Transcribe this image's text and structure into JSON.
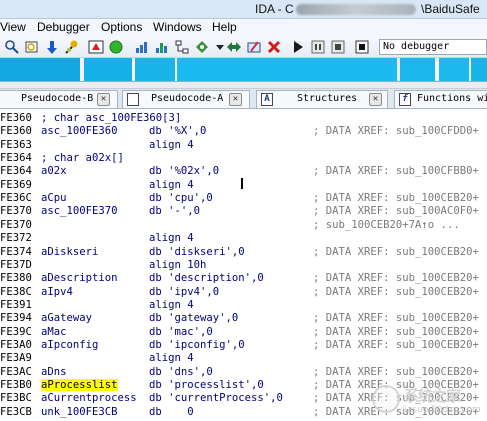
{
  "window": {
    "title_prefix": "IDA - C",
    "title_suffix": "\\BaiduSafe"
  },
  "menu": [
    "View",
    "Debugger",
    "Options",
    "Windows",
    "Help"
  ],
  "toolbar": {
    "debugger_select": "No debugger"
  },
  "tabs": [
    {
      "label": "Pseudocode-B"
    },
    {
      "label": "Pseudocode-A"
    },
    {
      "label": "Structures"
    },
    {
      "label": "Functions wind"
    }
  ],
  "listing": [
    {
      "addr": "FE360",
      "label": "; char asc_100FE360[3]",
      "op": "",
      "comment": "",
      "kind": "cmt"
    },
    {
      "addr": "FE360",
      "label": "asc_100FE360",
      "op": "db '%X',0",
      "comment": "; DATA XREF: sub_100CFDD0+",
      "kind": "data"
    },
    {
      "addr": "FE363",
      "label": "",
      "op": "align 4",
      "comment": "",
      "kind": "data"
    },
    {
      "addr": "FE364",
      "label": "; char a02x[]",
      "op": "",
      "comment": "",
      "kind": "cmt"
    },
    {
      "addr": "FE364",
      "label": "a02x",
      "op": "db '%02x',0",
      "comment": "; DATA XREF: sub_100CFBB0+",
      "kind": "data"
    },
    {
      "addr": "FE369",
      "label": "",
      "op": "align 4",
      "comment": "",
      "kind": "data"
    },
    {
      "addr": "FE36C",
      "label": "aCpu",
      "op": "db 'cpu',0",
      "comment": "; DATA XREF: sub_100CEB20+",
      "kind": "data"
    },
    {
      "addr": "FE370",
      "label": "asc_100FE370",
      "op": "db '-',0",
      "comment": "; DATA XREF: sub_100AC0F0+",
      "kind": "data"
    },
    {
      "addr": "FE370",
      "label": "",
      "op": "",
      "comment": "; sub_100CEB20+7A↑o ...",
      "kind": "data"
    },
    {
      "addr": "FE372",
      "label": "",
      "op": "align 4",
      "comment": "",
      "kind": "data"
    },
    {
      "addr": "FE374",
      "label": "aDiskseri",
      "op": "db 'diskseri',0",
      "comment": "; DATA XREF: sub_100CEB20+",
      "kind": "data"
    },
    {
      "addr": "FE37D",
      "label": "",
      "op": "align 10h",
      "comment": "",
      "kind": "data"
    },
    {
      "addr": "FE380",
      "label": "aDescription",
      "op": "db 'description',0",
      "comment": "; DATA XREF: sub_100CEB20+",
      "kind": "data"
    },
    {
      "addr": "FE38C",
      "label": "aIpv4",
      "op": "db 'ipv4',0",
      "comment": "; DATA XREF: sub_100CEB20+",
      "kind": "data"
    },
    {
      "addr": "FE391",
      "label": "",
      "op": "align 4",
      "comment": "",
      "kind": "data"
    },
    {
      "addr": "FE394",
      "label": "aGateway",
      "op": "db 'gateway',0",
      "comment": "; DATA XREF: sub_100CEB20+",
      "kind": "data"
    },
    {
      "addr": "FE39C",
      "label": "aMac",
      "op": "db 'mac',0",
      "comment": "; DATA XREF: sub_100CEB20+",
      "kind": "data"
    },
    {
      "addr": "FE3A0",
      "label": "aIpconfig",
      "op": "db 'ipconfig',0",
      "comment": "; DATA XREF: sub_100CEB20+",
      "kind": "data"
    },
    {
      "addr": "FE3A9",
      "label": "",
      "op": "align 4",
      "comment": "",
      "kind": "data"
    },
    {
      "addr": "FE3AC",
      "label": "aDns",
      "op": "db 'dns',0",
      "comment": "; DATA XREF: sub_100CEB20+",
      "kind": "data"
    },
    {
      "addr": "FE3B0",
      "label": "aProcesslist",
      "op": "db 'processlist',0",
      "comment": "; DATA XREF: sub_100CEB20+",
      "kind": "data",
      "highlight": true
    },
    {
      "addr": "FE3BC",
      "label": "aCurrentprocess",
      "op": "db 'currentProcess',0",
      "comment": "; DATA XREF: sub_100CEB20+",
      "kind": "data"
    },
    {
      "addr": "FE3CB",
      "label": "unk_100FE3CB",
      "op": "db    0",
      "comment": "; DATA XREF: sub_100CEB20+",
      "kind": "data"
    }
  ],
  "watermark": {
    "brand": "ä½ç¾ç½å",
    "site": "jiasuo.50dzq.com"
  },
  "colors": {
    "nav_band": "#18b6e8",
    "label_blue": "#00007f",
    "comment_gray": "#7a7a7a",
    "highlight": "#ffff00"
  }
}
